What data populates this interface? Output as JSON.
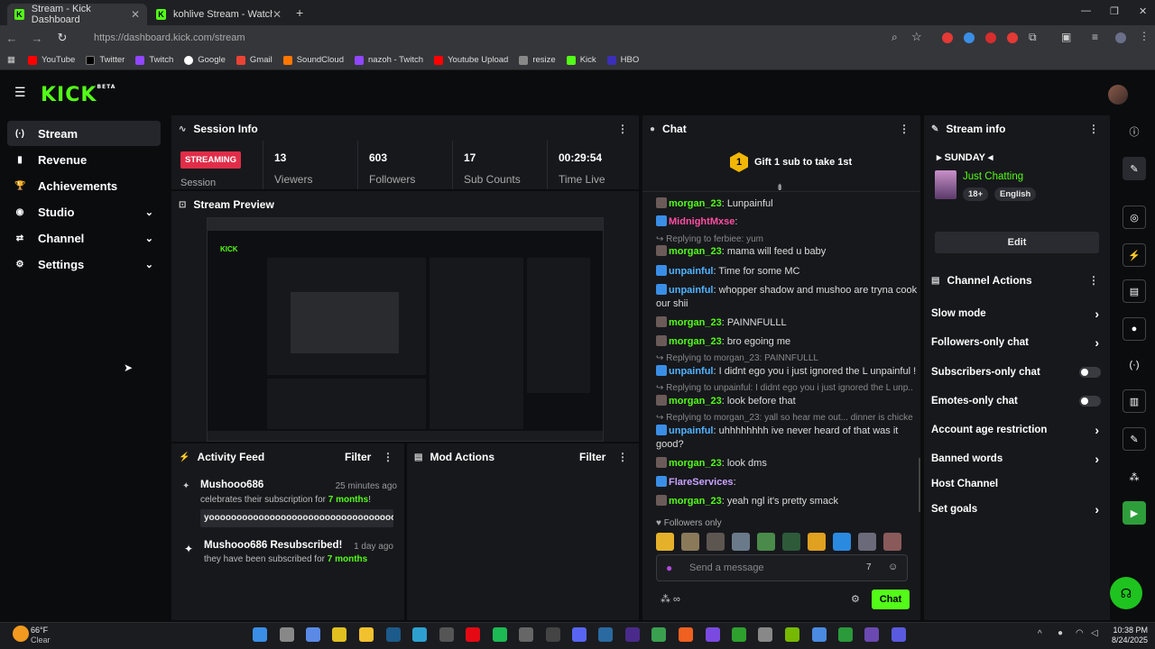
{
  "browser": {
    "tabs": [
      {
        "label": "Stream - Kick Dashboard",
        "active": true
      },
      {
        "label": "kohlive Stream - Watch Live on",
        "active": false
      }
    ],
    "url": "https://dashboard.kick.com/stream",
    "bookmarks": [
      "YouTube",
      "Twitter",
      "Twitch",
      "Google",
      "Gmail",
      "SoundCloud",
      "nazoh - Twitch",
      "Youtube Upload",
      "resize",
      "Kick",
      "HBO"
    ]
  },
  "kick": {
    "logo": "KICK",
    "logo_sup": "BETA",
    "accent": "#53fc18"
  },
  "sidebar": {
    "items": [
      {
        "label": "Stream",
        "icon": "broadcast-icon",
        "glyph": "(·)"
      },
      {
        "label": "Revenue",
        "icon": "chart-icon",
        "glyph": "▮"
      },
      {
        "label": "Achievements",
        "icon": "trophy-icon",
        "glyph": "🏆"
      },
      {
        "label": "Studio",
        "icon": "studio-icon",
        "glyph": "◉"
      },
      {
        "label": "Channel",
        "icon": "channel-icon",
        "glyph": "⇄"
      },
      {
        "label": "Settings",
        "icon": "gear-icon",
        "glyph": "⚙"
      }
    ]
  },
  "session": {
    "title": "Session Info",
    "status": "STREAMING",
    "session_label": "Session",
    "stats": [
      {
        "value": "13",
        "label": "Viewers"
      },
      {
        "value": "603",
        "label": "Followers"
      },
      {
        "value": "17",
        "label": "Sub Counts"
      },
      {
        "value": "00:29:54",
        "label": "Time Live"
      }
    ]
  },
  "preview": {
    "title": "Stream Preview"
  },
  "activity": {
    "title": "Activity Feed",
    "filter": "Filter",
    "items": [
      {
        "user": "Mushooo686",
        "time": "25 minutes ago",
        "text_pre": "celebrates their subscription for ",
        "months": "7 months",
        "text_post": "!",
        "message": "yoooooooooooooooooooooooooooooooooooooooooo"
      },
      {
        "user": "Mushooo686 Resubscribed!",
        "time": "1 day ago",
        "text_pre": "they have been subscribed for ",
        "months": "7 months",
        "text_post": ""
      }
    ]
  },
  "mod": {
    "title": "Mod Actions",
    "filter": "Filter"
  },
  "chat": {
    "title": "Chat",
    "gift_rank": "1",
    "gift_text": "Gift 1 sub to take 1st",
    "followers_only": "Followers only",
    "placeholder": "Send a message",
    "send": "Chat",
    "lines": [
      {
        "type": "msg",
        "user": "morgan_23",
        "color": "#53fc18",
        "text": "Lunpainful"
      },
      {
        "type": "msg",
        "user": "MidnightMxse",
        "color": "#ff4fa3",
        "text": ""
      },
      {
        "type": "reply",
        "text": "Replying to ferbiee: yum"
      },
      {
        "type": "msg",
        "user": "morgan_23",
        "color": "#53fc18",
        "text": "mama will feed u baby"
      },
      {
        "type": "msg",
        "user": "unpainful",
        "color": "#4fb3ff",
        "text": "Time for some MC"
      },
      {
        "type": "msg",
        "user": "unpainful",
        "color": "#4fb3ff",
        "text": "whopper shadow and mushoo are tryna cook our shii"
      },
      {
        "type": "msg",
        "user": "morgan_23",
        "color": "#53fc18",
        "text": "PAINNFULLL"
      },
      {
        "type": "msg",
        "user": "morgan_23",
        "color": "#53fc18",
        "text": "bro egoing me"
      },
      {
        "type": "reply",
        "text": "Replying to morgan_23: PAINNFULLL"
      },
      {
        "type": "msg",
        "user": "unpainful",
        "color": "#4fb3ff",
        "text": "I didnt ego you i just ignored the L unpainful !"
      },
      {
        "type": "reply",
        "text": "Replying to unpainful: I didnt ego you i just ignored the L unp..."
      },
      {
        "type": "msg",
        "user": "morgan_23",
        "color": "#53fc18",
        "text": "look before that"
      },
      {
        "type": "reply",
        "text": "Replying to morgan_23: yall so hear me out... dinner is chicke..."
      },
      {
        "type": "msg",
        "user": "unpainful",
        "color": "#4fb3ff",
        "text": "uhhhhhhhh ive never heard of that was it good?"
      },
      {
        "type": "msg",
        "user": "morgan_23",
        "color": "#53fc18",
        "text": "look dms"
      },
      {
        "type": "msg",
        "user": "FlareServices",
        "color": "#c8a2ff",
        "text": ""
      },
      {
        "type": "msg",
        "user": "morgan_23",
        "color": "#53fc18",
        "text": "yeah ngl it's pretty smack"
      }
    ]
  },
  "stream_info": {
    "title": "Stream info",
    "stream_title": "SUNDAY",
    "category": "Just Chatting",
    "tags": [
      "18+",
      "English"
    ],
    "edit": "Edit"
  },
  "channel_actions": {
    "title": "Channel Actions",
    "items": [
      {
        "label": "Slow mode",
        "control": "arrow"
      },
      {
        "label": "Followers-only chat",
        "control": "arrow"
      },
      {
        "label": "Subscribers-only chat",
        "control": "toggle"
      },
      {
        "label": "Emotes-only chat",
        "control": "toggle"
      },
      {
        "label": "Account age restriction",
        "control": "arrow"
      },
      {
        "label": "Banned words",
        "control": "arrow"
      },
      {
        "label": "Host Channel",
        "control": "none"
      },
      {
        "label": "Set goals",
        "control": "arrow"
      }
    ]
  },
  "taskbar": {
    "weather_temp": "66°F",
    "weather_text": "Clear",
    "time": "10:38 PM",
    "date": "8/24/2025"
  }
}
